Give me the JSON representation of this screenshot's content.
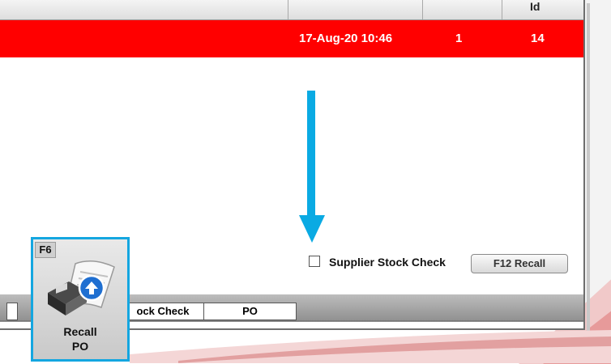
{
  "table": {
    "header_last_col": "Id",
    "selected_row": {
      "date": "17-Aug-20 10:46",
      "count": "1",
      "id": "14"
    }
  },
  "options": {
    "supplier_stock_check_label": "Supplier Stock Check",
    "supplier_stock_check_checked": false
  },
  "buttons": {
    "recall_label": "F12  Recall"
  },
  "bottom_tabs": [
    "ock Check",
    "PO"
  ],
  "f6_button": {
    "key": "F6",
    "label_line1": "Recall",
    "label_line2": "PO",
    "icon": "recall-po-icon"
  },
  "colors": {
    "selected_row": "#ff0000",
    "highlight": "#14a6e0",
    "arrow": "#0aaae3"
  }
}
